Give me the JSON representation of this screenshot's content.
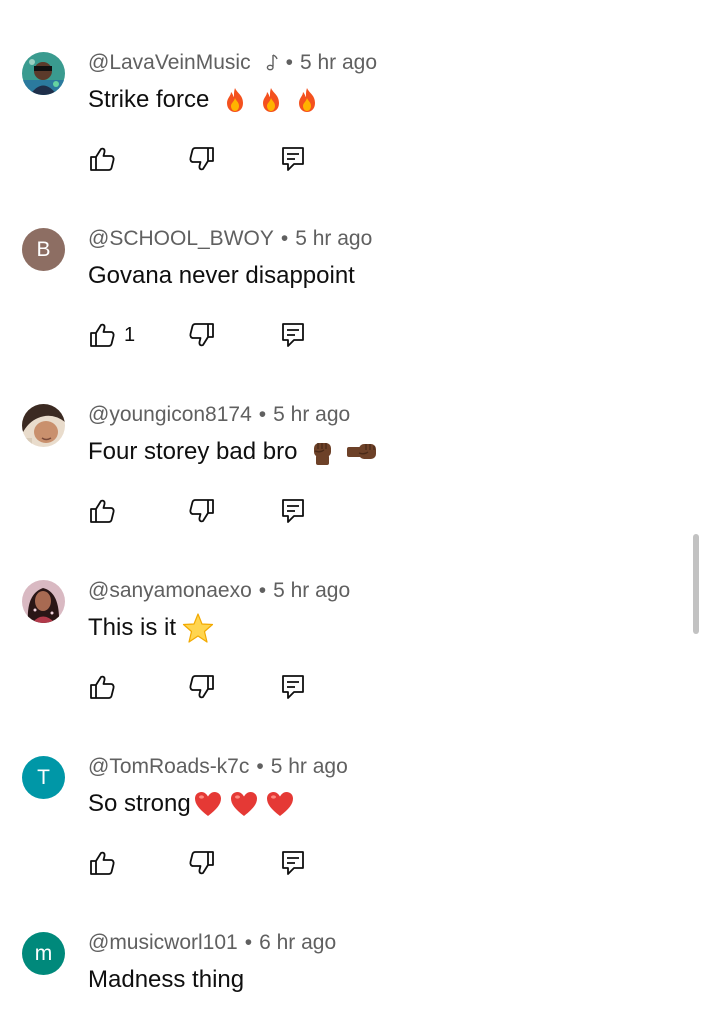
{
  "comments": [
    {
      "handle": "@LavaVeinMusic",
      "has_music_note": true,
      "separator": "•",
      "time": "5 hr ago",
      "text": "Strike force",
      "emojis": [
        "fire-emoji",
        "fire-emoji",
        "fire-emoji"
      ],
      "likes": "",
      "avatar": {
        "type": "image",
        "label": ""
      }
    },
    {
      "handle": "@SCHOOL_BWOY",
      "separator": "•",
      "time": "5 hr ago",
      "text": "Govana never disappoint",
      "emojis": [],
      "likes": "1",
      "avatar": {
        "type": "letter",
        "label": "B",
        "color": "#8d6e63"
      }
    },
    {
      "handle": "@youngicon8174",
      "separator": "•",
      "time": "5 hr ago",
      "text": "Four storey bad bro",
      "emojis": [
        "raised-fist-emoji",
        "right-facing-fist-emoji"
      ],
      "likes": "",
      "avatar": {
        "type": "image",
        "label": ""
      }
    },
    {
      "handle": "@sanyamonaexo",
      "separator": "•",
      "time": "5 hr ago",
      "text": "This is it",
      "emojis": [
        "star-emoji"
      ],
      "likes": "",
      "avatar": {
        "type": "image",
        "label": ""
      }
    },
    {
      "handle": "@TomRoads-k7c",
      "separator": "•",
      "time": "5 hr ago",
      "text": "So strong",
      "emojis": [
        "red-heart-emoji",
        "red-heart-emoji",
        "red-heart-emoji"
      ],
      "likes": "",
      "avatar": {
        "type": "letter",
        "label": "T",
        "color": "#0097a7"
      }
    },
    {
      "handle": "@musicworl101",
      "separator": "•",
      "time": "6 hr ago",
      "text": "Madness thing",
      "emojis": [],
      "likes": "",
      "avatar": {
        "type": "letter",
        "label": "m",
        "color": "#00897b"
      }
    }
  ],
  "icons": {
    "like": "thumbs-up-icon",
    "dislike": "thumbs-down-icon",
    "reply": "reply-comment-icon",
    "creator_badge": "music-note-icon"
  },
  "colors": {
    "secondary_text": "#606060",
    "primary_text": "#0f0f0f",
    "scrollbar": "#c2c2c2"
  }
}
